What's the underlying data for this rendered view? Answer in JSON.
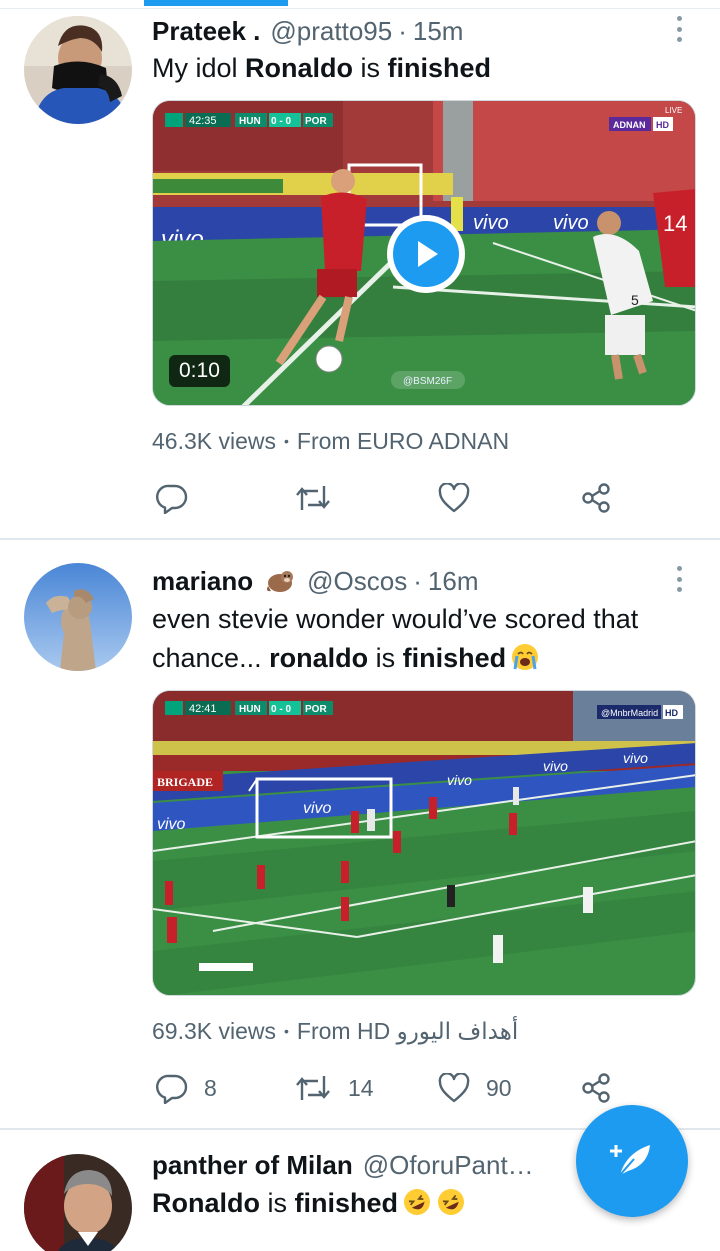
{
  "tweets": [
    {
      "name": "Prateek .",
      "handle": "@pratto95",
      "time": "15m",
      "text_parts": [
        "My idol ",
        "Ronaldo",
        " is ",
        "finished"
      ],
      "video": {
        "duration": "0:10",
        "scoreboard": {
          "clock": "42:35",
          "home": "HUN",
          "score": "0 - 0",
          "away": "POR"
        },
        "channel_tag": "ADNAN",
        "quality": "HD",
        "live_label": "LIVE",
        "watermark": "@BSM26F",
        "ad_text": "vivo",
        "player_number": "14",
        "player_number_2": "5"
      },
      "views": "46.3K views",
      "source": "From EURO ADNAN",
      "reply_count": "",
      "retweet_count": "",
      "like_count": ""
    },
    {
      "name": "mariano",
      "name_emoji": "otter-emoji",
      "handle": "@Oscos",
      "time": "16m",
      "text_parts": [
        "even stevie wonder would’ve scored that chance... ",
        "ronaldo",
        " is ",
        "finished"
      ],
      "trailing_emoji": "crying-face-emoji",
      "video": {
        "scoreboard": {
          "clock": "42:41",
          "home": "HUN",
          "score": "0 - 0",
          "away": "POR"
        },
        "channel_tag": "@MnbrMadrid",
        "quality": "HD",
        "banner_text": "BRIGADE",
        "ad_text": "vivo"
      },
      "views": "69.3K views",
      "source": "From HD أهداف اليورو",
      "reply_count": "8",
      "retweet_count": "14",
      "like_count": "90"
    },
    {
      "name": "panther of Milan",
      "handle": "@OforuPant…",
      "text_parts": [
        "Ronaldo",
        " is ",
        "finished"
      ],
      "trailing_emoji": "rolling-laughing-emoji-x2"
    }
  ],
  "separator": "·",
  "views_separator": "•",
  "colors": {
    "accent": "#1d9bf0",
    "text_primary": "#0f1419",
    "text_secondary": "#536471",
    "divider": "#e1e8ed"
  },
  "icons": {
    "reply": "reply-icon",
    "retweet": "retweet-icon",
    "like": "heart-icon",
    "share": "share-icon",
    "more": "more-vertical-icon",
    "play": "play-icon",
    "compose": "compose-tweet-icon"
  }
}
